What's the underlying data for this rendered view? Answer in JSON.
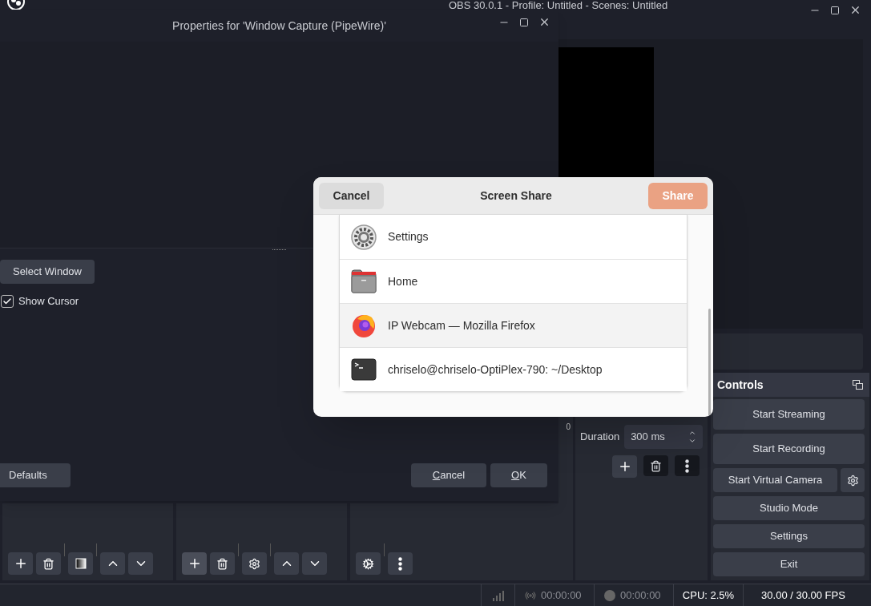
{
  "main_window": {
    "title": "OBS 30.0.1 - Profile: Untitled - Scenes: Untitled"
  },
  "properties_dialog": {
    "title": "Properties for 'Window Capture (PipeWire)'",
    "select_window": "Select Window",
    "show_cursor": {
      "label": "Show Cursor",
      "checked": true
    },
    "defaults": "Defaults",
    "cancel": "Cancel",
    "ok": "OK"
  },
  "screen_share": {
    "title": "Screen Share",
    "cancel": "Cancel",
    "share": {
      "label": "Share",
      "disabled": true
    },
    "windows": [
      {
        "name": "Settings",
        "kind": "settings",
        "selected": false
      },
      {
        "name": "Home",
        "kind": "folder",
        "selected": false
      },
      {
        "name": "IP Webcam — Mozilla Firefox",
        "kind": "browser",
        "selected": true
      },
      {
        "name": "chriselo@chriselo-OptiPlex-790: ~/Desktop",
        "kind": "terminal",
        "selected": false
      }
    ]
  },
  "audio_mixer": {
    "tick": "0"
  },
  "transitions": {
    "duration_label": "Duration",
    "duration_value": "300 ms"
  },
  "controls": {
    "title": "Controls",
    "buttons": [
      {
        "label": "Start Streaming",
        "kind": "plain"
      },
      {
        "label": "Start Recording",
        "kind": "plain"
      },
      {
        "label": "Start Virtual Camera",
        "kind": "with_settings"
      },
      {
        "label": "Studio Mode",
        "kind": "plain"
      },
      {
        "label": "Settings",
        "kind": "plain"
      },
      {
        "label": "Exit",
        "kind": "plain"
      }
    ]
  },
  "status_bar": {
    "stream_time": "00:00:00",
    "record_time": "00:00:00",
    "cpu": "CPU: 2.5%",
    "fps": "30.00 / 30.00 FPS"
  }
}
